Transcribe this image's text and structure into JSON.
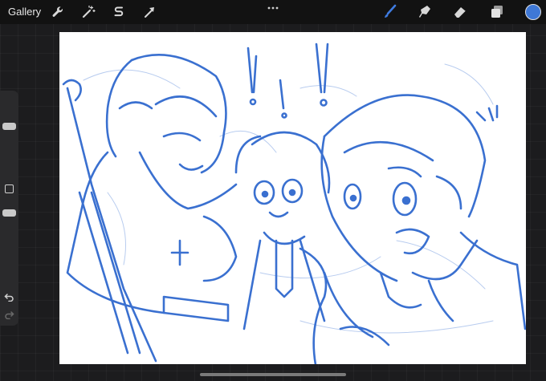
{
  "topbar": {
    "gallery_label": "Gallery",
    "left_tools": [
      {
        "name": "actions",
        "icon": "wrench-icon"
      },
      {
        "name": "adjustments",
        "icon": "magic-wand-icon"
      },
      {
        "name": "selection",
        "icon": "selection-s-icon"
      },
      {
        "name": "transform",
        "icon": "arrow-cursor-icon"
      }
    ],
    "more_icon": "more-dots-icon",
    "right_tools": [
      {
        "name": "brush",
        "icon": "brush-icon",
        "active": true
      },
      {
        "name": "smudge",
        "icon": "smudge-finger-icon",
        "active": false
      },
      {
        "name": "eraser",
        "icon": "eraser-icon",
        "active": false
      },
      {
        "name": "layers",
        "icon": "layers-icon",
        "active": false
      }
    ],
    "current_color": "#3f78d6"
  },
  "sidebar": {
    "brush_size_level": 0.2,
    "opacity_level": 0.25,
    "modify_icon": "square-modify-icon",
    "undo_icon": "undo-arrow-icon",
    "redo_icon": "redo-arrow-icon"
  },
  "canvas": {
    "background": "#ffffff",
    "stroke_color": "#3a70d0",
    "description_icon": "sketch-artwork"
  },
  "colors": {
    "active_tool": "#3f7be0",
    "inactive_tool": "#d8d8d8",
    "bar": "#121212"
  }
}
